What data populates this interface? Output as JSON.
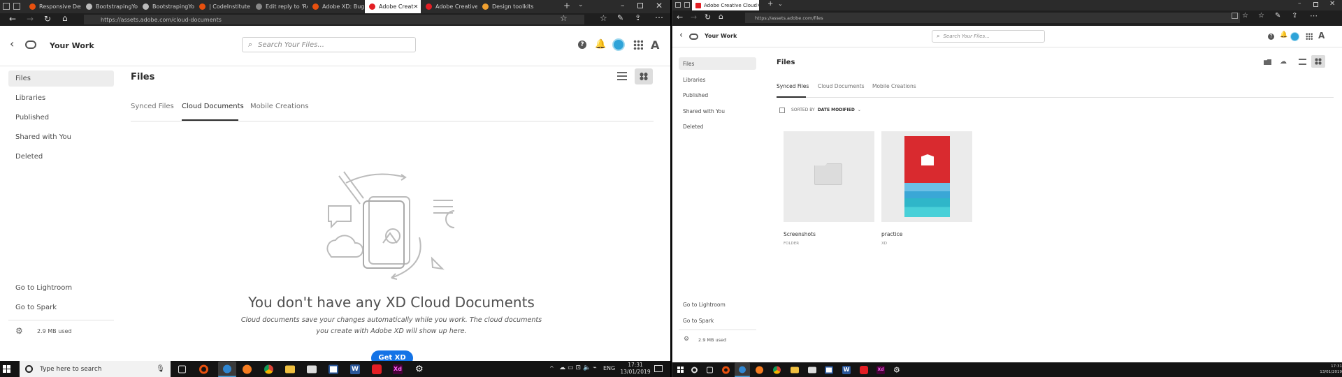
{
  "left": {
    "browser": {
      "tabs": [
        {
          "label": "Responsive Desi"
        },
        {
          "label": "BootstrapingYo."
        },
        {
          "label": "BootstrapingYo."
        },
        {
          "label": "| CodeInstitute"
        },
        {
          "label": "Edit reply to 'Re:"
        },
        {
          "label": "Adobe XD: Bugs"
        },
        {
          "label": "Adobe Creat"
        },
        {
          "label": "Adobe Creative"
        },
        {
          "label": "Design toolkits ("
        }
      ],
      "active_tab_index": 6,
      "url": "https://assets.adobe.com/cloud-documents"
    },
    "app": {
      "title": "Your Work",
      "search_placeholder": "Search Your Files...",
      "sidebar": [
        "Files",
        "Libraries",
        "Published",
        "Shared with You",
        "Deleted"
      ],
      "sidebar_links": [
        "Go to Lightroom",
        "Go to Spark"
      ],
      "storage": "2.9 MB used",
      "page_title": "Files",
      "tabs": [
        "Synced Files",
        "Cloud Documents",
        "Mobile Creations"
      ],
      "active_tab": 1,
      "empty_title": "You don't have any XD Cloud Documents",
      "empty_text_1": "Cloud documents save your changes automatically while you work. The cloud documents",
      "empty_text_2": "you create with Adobe XD will show up here.",
      "cta": "Get XD"
    },
    "taskbar": {
      "search_placeholder": "Type here to search",
      "lang": "ENG",
      "time": "17:31",
      "date": "13/01/2019"
    }
  },
  "right": {
    "browser": {
      "tab": "Adobe Creative Cloud",
      "url": "https://assets.adobe.com/files"
    },
    "app": {
      "title": "Your Work",
      "search_placeholder": "Search Your Files...",
      "sidebar": [
        "Files",
        "Libraries",
        "Published",
        "Shared with You",
        "Deleted"
      ],
      "sidebar_links": [
        "Go to Lightroom",
        "Go to Spark"
      ],
      "storage": "2.9 MB used",
      "page_title": "Files",
      "tabs": [
        "Synced Files",
        "Cloud Documents",
        "Mobile Creations"
      ],
      "active_tab": 0,
      "sort_prefix": "SORTED BY",
      "sort_value": "DATE MODIFIED",
      "items": [
        {
          "name": "Screenshots",
          "type": "FOLDER"
        },
        {
          "name": "practice",
          "type": "XD"
        }
      ]
    },
    "taskbar": {
      "time": "17:31",
      "date": "13/01/2019"
    }
  },
  "colors": {
    "accent_blue": "#1473e6",
    "adobe_red": "#e31e24",
    "taskbar": "#141414",
    "browser_tabbar": "#2b2b2b"
  }
}
